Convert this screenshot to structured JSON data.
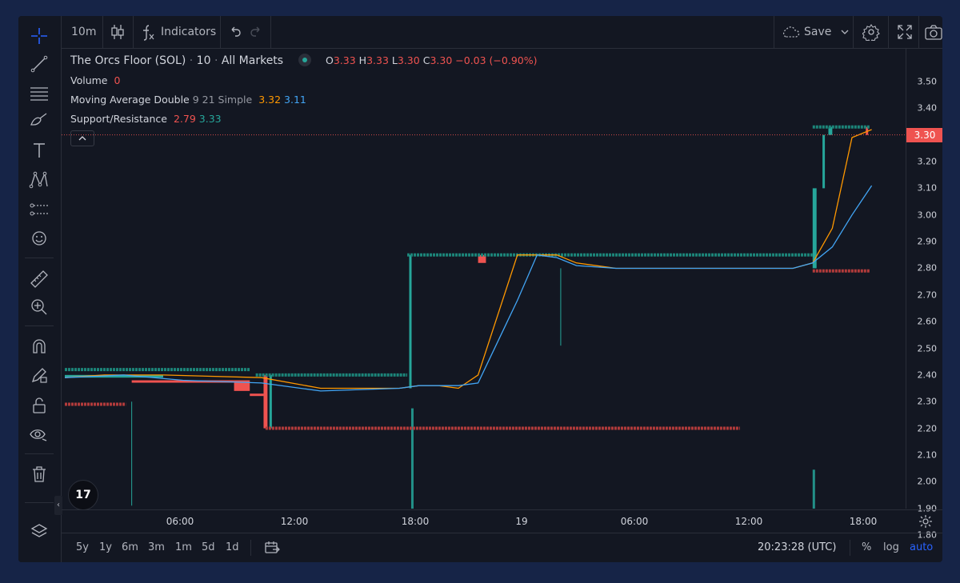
{
  "toolbar": {
    "interval": "10m",
    "indicators_label": "Indicators",
    "save_label": "Save"
  },
  "legend": {
    "symbol": "The Orcs Floor (SOL)",
    "interval": "10",
    "exchange": "All Markets",
    "o_label": "O",
    "o_value": "3.33",
    "h_label": "H",
    "h_value": "3.33",
    "l_label": "L",
    "l_value": "3.30",
    "c_label": "C",
    "c_value": "3.30",
    "change": "−0.03 (−0.90%)",
    "volume_label": "Volume",
    "volume_value": "0",
    "ma_label": "Moving Average Double",
    "ma_params": "9 21 Simple",
    "ma_fast": "3.32",
    "ma_slow": "3.11",
    "sr_label": "Support/Resistance",
    "sr_support": "2.79",
    "sr_resistance": "3.33"
  },
  "price_axis": {
    "ticks": [
      "3.50",
      "3.40",
      "3.30",
      "3.20",
      "3.10",
      "3.00",
      "2.90",
      "2.80",
      "2.70",
      "2.60",
      "2.50",
      "2.40",
      "2.30",
      "2.20",
      "2.10",
      "2.00",
      "1.90",
      "1.80"
    ],
    "last_price": "3.30"
  },
  "time_axis": {
    "ticks": [
      "06:00",
      "12:00",
      "18:00",
      "19",
      "06:00",
      "12:00",
      "18:00"
    ]
  },
  "bottom": {
    "ranges": [
      "5y",
      "1y",
      "6m",
      "3m",
      "1m",
      "5d",
      "1d"
    ],
    "clock": "20:23:28 (UTC)",
    "percent": "%",
    "log": "log",
    "auto": "auto"
  },
  "colors": {
    "up": "#26a69a",
    "down": "#ef5350",
    "ma_fast": "#ff9800",
    "ma_slow": "#42a5f5",
    "accent": "#2962ff"
  },
  "chart_data": {
    "type": "line",
    "ylim": [
      1.75,
      3.52
    ],
    "x_ticks": [
      "06:00",
      "12:00",
      "18:00",
      "19",
      "06:00",
      "12:00",
      "18:00"
    ],
    "series": [
      {
        "values": [
          [
            0,
            2.39
          ],
          [
            2,
            2.4
          ],
          [
            5,
            2.4
          ],
          [
            10,
            2.39
          ],
          [
            13,
            2.35
          ],
          [
            17,
            2.35
          ],
          [
            18,
            2.36
          ],
          [
            19,
            2.36
          ],
          [
            20,
            2.35
          ],
          [
            21,
            2.4
          ],
          [
            23,
            2.85
          ],
          [
            25,
            2.85
          ],
          [
            26,
            2.82
          ],
          [
            28,
            2.8
          ],
          [
            31,
            2.8
          ],
          [
            37,
            2.8
          ],
          [
            38,
            2.82
          ],
          [
            39,
            2.95
          ],
          [
            40,
            3.29
          ],
          [
            41,
            3.32
          ]
        ]
      },
      {
        "values": [
          [
            0,
            2.39
          ],
          [
            3,
            2.4
          ],
          [
            6,
            2.38
          ],
          [
            10,
            2.37
          ],
          [
            13,
            2.34
          ],
          [
            17,
            2.35
          ],
          [
            18,
            2.36
          ],
          [
            20,
            2.36
          ],
          [
            21,
            2.37
          ],
          [
            23,
            2.68
          ],
          [
            24,
            2.85
          ],
          [
            25,
            2.84
          ],
          [
            26,
            2.81
          ],
          [
            28,
            2.8
          ],
          [
            37,
            2.8
          ],
          [
            38,
            2.82
          ],
          [
            39,
            2.88
          ],
          [
            40,
            3.0
          ],
          [
            41,
            3.11
          ]
        ]
      }
    ],
    "support_resistance": [
      {
        "values": [
          [
            0,
            2.42
          ],
          [
            9.4,
            2.42
          ]
        ]
      },
      {
        "values": [
          [
            0,
            2.29
          ],
          [
            3.1,
            2.29
          ]
        ]
      },
      {
        "values": [
          [
            9.7,
            2.4
          ],
          [
            17.4,
            2.4
          ]
        ]
      },
      {
        "values": [
          [
            10.2,
            2.2
          ],
          [
            34.3,
            2.2
          ]
        ]
      },
      {
        "values": [
          [
            17.4,
            2.85
          ],
          [
            38.0,
            2.85
          ]
        ]
      },
      {
        "values": [
          [
            38.0,
            2.79
          ],
          [
            40.9,
            2.79
          ]
        ]
      },
      {
        "values": [
          [
            38.0,
            3.33
          ],
          [
            40.9,
            3.33
          ]
        ]
      }
    ]
  }
}
